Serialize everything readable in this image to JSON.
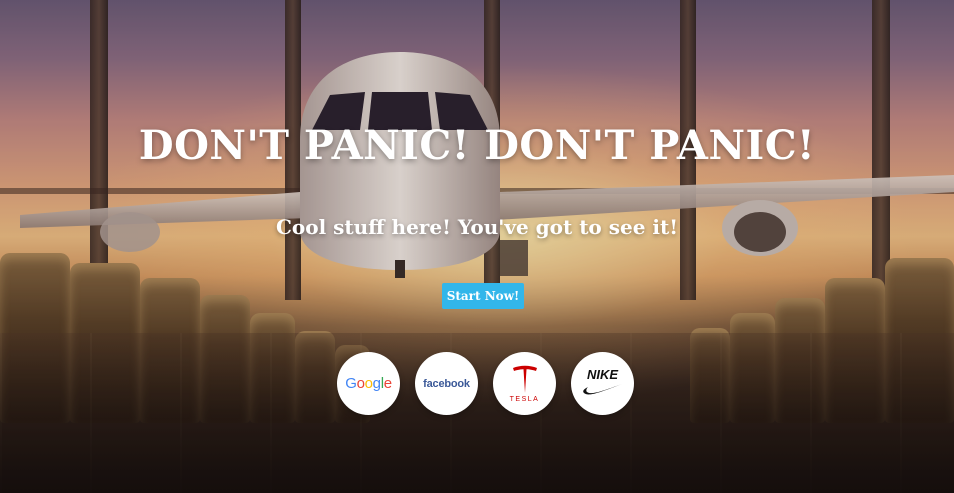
{
  "hero": {
    "headline": "DON'T PANIC! DON'T PANIC!",
    "subheadline": "Cool stuff here! You've got to see it!",
    "cta_label": "Start Now!"
  },
  "logos": [
    {
      "name": "Google",
      "text": "Google"
    },
    {
      "name": "Facebook",
      "text": "facebook"
    },
    {
      "name": "Tesla",
      "text": "TESLA"
    },
    {
      "name": "Nike",
      "text": "NIKE"
    }
  ],
  "colors": {
    "cta_background": "#32b6ea",
    "text": "#ffffff",
    "facebook_blue": "#3b5998",
    "tesla_red": "#cc0000"
  }
}
